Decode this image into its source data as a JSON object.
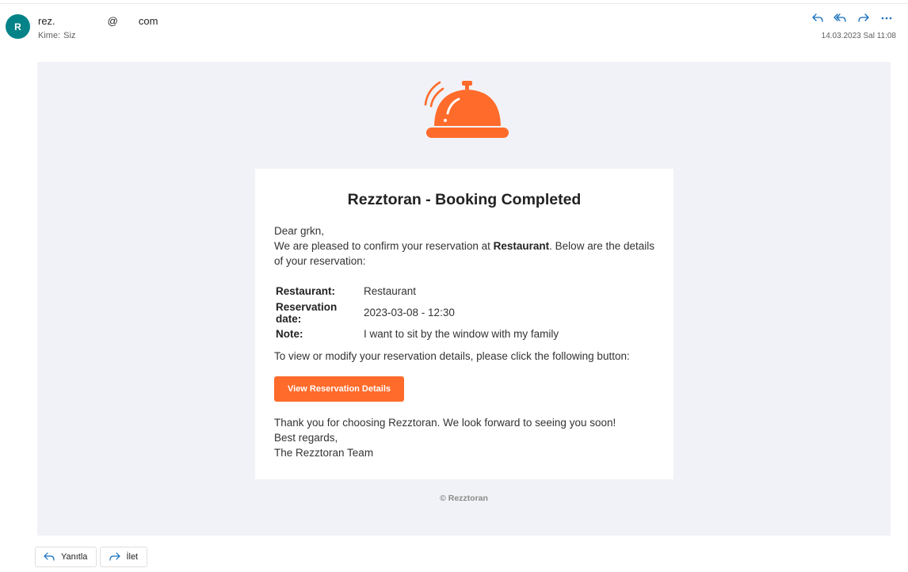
{
  "header": {
    "avatar_initial": "R",
    "sender_part1": "rez.",
    "sender_at": "@",
    "sender_domain": "com",
    "to_label": "Kime:",
    "to_value": "Siz",
    "datetime": "14.03.2023 Sal 11:08",
    "actions": [
      {
        "icon": "reply-icon"
      },
      {
        "icon": "reply-all-icon"
      },
      {
        "icon": "forward-icon"
      },
      {
        "icon": "more-options-icon"
      }
    ]
  },
  "email": {
    "title": "Rezztoran - Booking Completed",
    "greeting": "Dear grkn,",
    "intro_before": "We are pleased to confirm your reservation at ",
    "intro_bold": "Restaurant",
    "intro_after": ". Below are the details of your reservation:",
    "details": [
      {
        "label": "Restaurant:",
        "value": "Restaurant"
      },
      {
        "label": "Reservation date:",
        "value": "2023-03-08 - 12:30"
      },
      {
        "label": "Note:",
        "value": "I want to sit by the window with my family"
      }
    ],
    "view_text": "To view or modify your reservation details, please click the following button:",
    "button_label": "View Reservation Details",
    "thanks": "Thank you for choosing Rezztoran. We look forward to seeing you soon!",
    "regards": "Best regards,",
    "signature": "The Rezztoran Team",
    "copyright": "© Rezztoran"
  },
  "footer": {
    "reply_label": "Yanıtla",
    "forward_label": "İlet"
  },
  "colors": {
    "accent": "#ff6b2b",
    "avatar_bg": "#038387",
    "action_icon": "#0f6cbd",
    "canvas_bg": "#f1f2f7"
  }
}
